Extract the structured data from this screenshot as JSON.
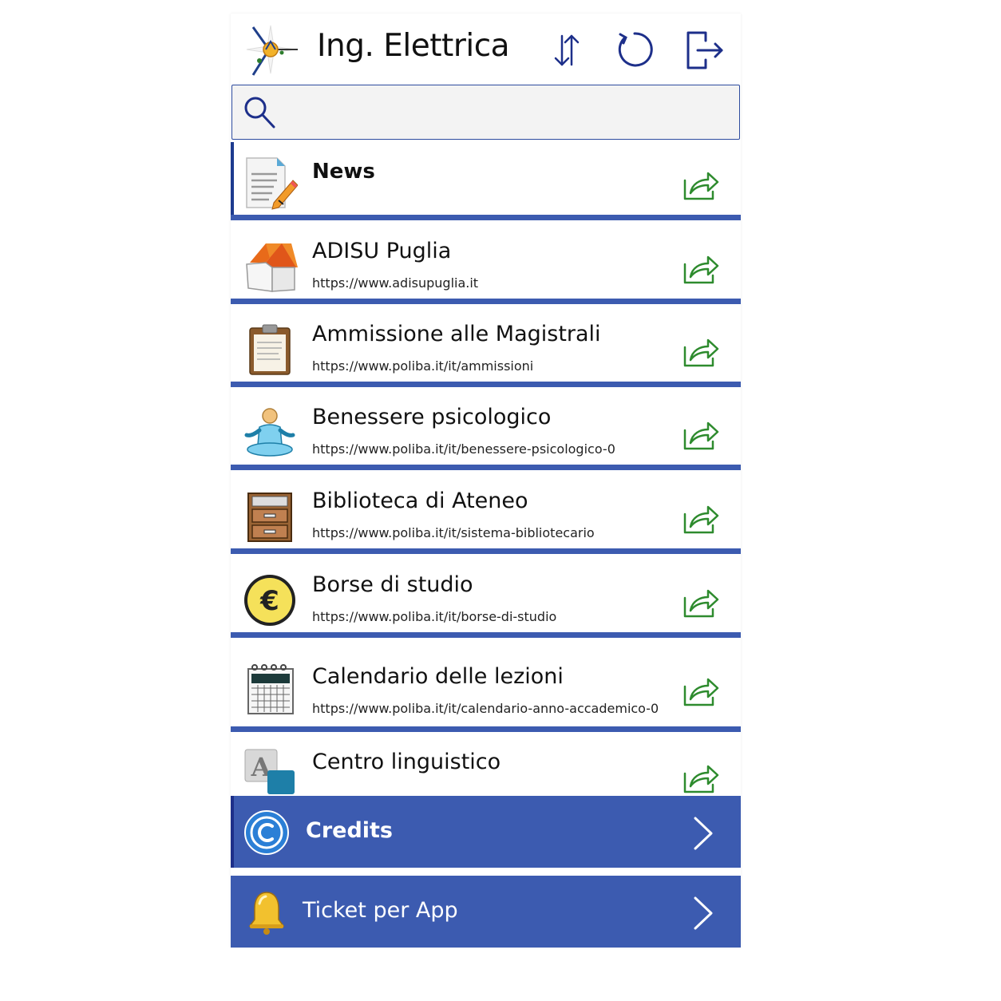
{
  "header": {
    "title": "Ing. Elettrica",
    "logo_icon": "compass-star-logo-icon",
    "sort_icon": "sort-arrows-icon",
    "refresh_icon": "refresh-icon",
    "logout_icon": "logout-icon"
  },
  "search": {
    "placeholder": "",
    "value": "",
    "icon": "search-icon"
  },
  "items": [
    {
      "title": "News",
      "url": "",
      "icon": "news-document-icon"
    },
    {
      "title": "ADISU Puglia",
      "url": "https://www.adisupuglia.it",
      "icon": "house-icon"
    },
    {
      "title": "Ammissione alle Magistrali",
      "url": "https://www.poliba.it/it/ammissioni",
      "icon": "clipboard-icon"
    },
    {
      "title": "Benessere psicologico",
      "url": "https://www.poliba.it/it/benessere-psicologico-0",
      "icon": "meditation-icon"
    },
    {
      "title": "Biblioteca di Ateneo",
      "url": "https://www.poliba.it/it/sistema-bibliotecario",
      "icon": "file-cabinet-icon"
    },
    {
      "title": "Borse di studio",
      "url": "https://www.poliba.it/it/borse-di-studio",
      "icon": "euro-coin-icon"
    },
    {
      "title": "Calendario delle lezioni",
      "url": "https://www.poliba.it/it/calendario-anno-accademico-0",
      "icon": "calendar-icon"
    },
    {
      "title": "Centro linguistico",
      "url": "",
      "icon": "language-icon"
    }
  ],
  "footer": [
    {
      "label": "Credits",
      "icon": "copyright-icon"
    },
    {
      "label": "Ticket per App",
      "icon": "bell-icon"
    }
  ],
  "colors": {
    "accent": "#3c5bb0",
    "navy": "#1d2f8a",
    "share_green": "#2e8b2e"
  }
}
